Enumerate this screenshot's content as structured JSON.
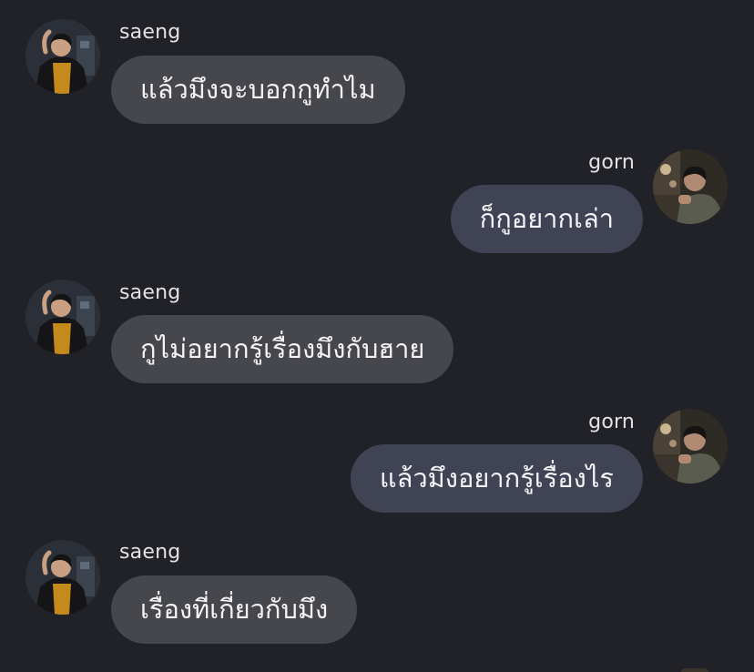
{
  "theme": {
    "background": "#212228",
    "incoming_bubble": "#46474c",
    "outgoing_bubble": "#3f4354",
    "text": "#f4f4f6"
  },
  "messages": [
    {
      "sender": "saeng",
      "side": "left",
      "text": "แล้วมึงจะบอกกูทำไม",
      "avatar_icon": "saeng-avatar-icon"
    },
    {
      "sender": "gorn",
      "side": "right",
      "text": "ก็กูอยากเล่า",
      "avatar_icon": "gorn-avatar-icon"
    },
    {
      "sender": "saeng",
      "side": "left",
      "text": "กูไม่อยากรู้เรื่องมึงกับฮาย",
      "avatar_icon": "saeng-avatar-icon"
    },
    {
      "sender": "gorn",
      "side": "right",
      "text": "แล้วมึงอยากรู้เรื่องไร",
      "avatar_icon": "gorn-avatar-icon"
    },
    {
      "sender": "saeng",
      "side": "left",
      "text": "เรื่องที่เกี่ยวกับมึง",
      "avatar_icon": "saeng-avatar-icon"
    }
  ]
}
